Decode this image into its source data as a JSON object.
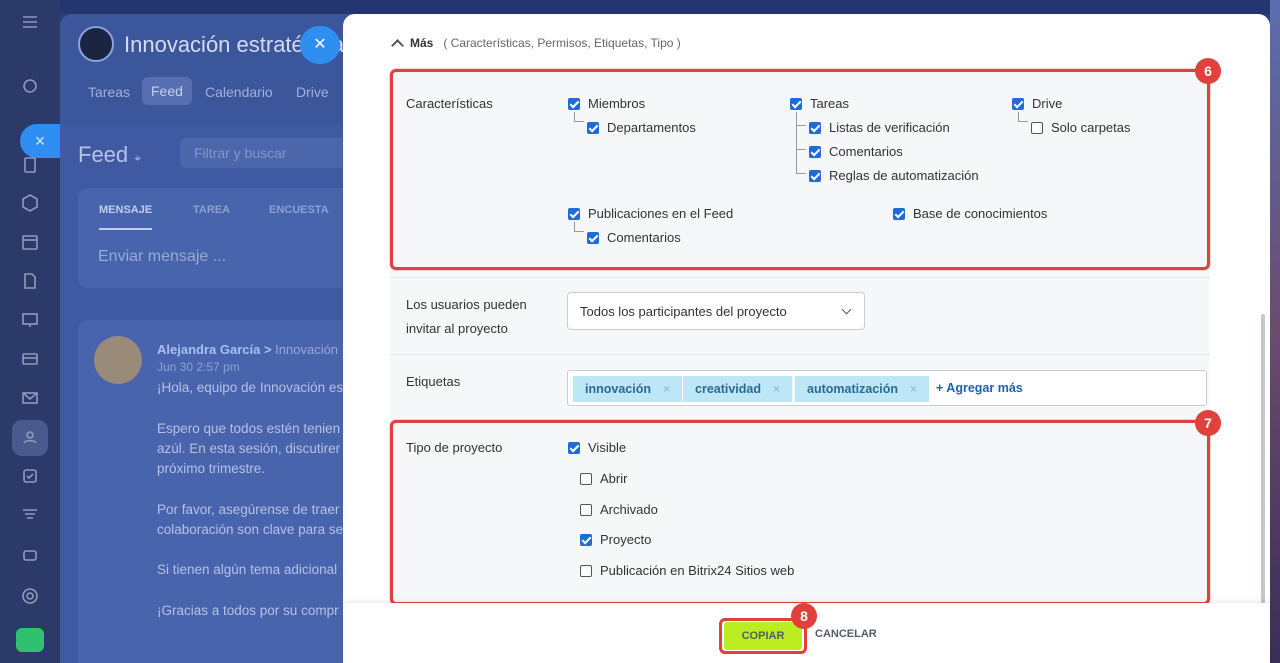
{
  "background": {
    "project_title": "Innovación estratégica",
    "tabs": [
      "Tareas",
      "Feed",
      "Calendario",
      "Drive"
    ],
    "feed_title": "Feed",
    "filter_placeholder": "Filtrar y buscar",
    "composer_tabs": [
      "MENSAJE",
      "TAREA",
      "ENCUESTA"
    ],
    "composer_placeholder": "Enviar mensaje ...",
    "post": {
      "author": "Alejandra García",
      "project": "Innovación",
      "date": "Jun 30 2:57 pm",
      "lines": [
        "¡Hola, equipo de Innovación es",
        "Espero que todos estén tenien",
        "azúl. En esta sesión, discutirer",
        "próximo trimestre.",
        "Por favor, asegúrense de traer",
        "colaboración son clave para se",
        "Si tienen algún tema adicional",
        "¡Gracias a todos por su compr"
      ]
    }
  },
  "modal": {
    "mas_label": "Más",
    "mas_sub": "( Características, Permisos, Etiquetas, Tipo )",
    "features": {
      "label": "Características",
      "items": {
        "miembros": {
          "label": "Miembros",
          "checked": true
        },
        "departamentos": {
          "label": "Departamentos",
          "checked": true
        },
        "tareas": {
          "label": "Tareas",
          "checked": true
        },
        "listas": {
          "label": "Listas de verificación",
          "checked": true
        },
        "comentarios_tareas": {
          "label": "Comentarios",
          "checked": true
        },
        "reglas": {
          "label": "Reglas de automatización",
          "checked": true
        },
        "drive": {
          "label": "Drive",
          "checked": true
        },
        "solo_carpetas": {
          "label": "Solo carpetas",
          "checked": false
        },
        "publicaciones": {
          "label": "Publicaciones en el Feed",
          "checked": true
        },
        "comentarios_feed": {
          "label": "Comentarios",
          "checked": true
        },
        "base": {
          "label": "Base de conocimientos",
          "checked": true
        }
      }
    },
    "invite": {
      "label_line1": "Los usuarios pueden",
      "label_line2": "invitar al proyecto",
      "value": "Todos los participantes del proyecto"
    },
    "tags": {
      "label": "Etiquetas",
      "items": [
        "innovación",
        "creatividad",
        "automatización"
      ],
      "remove_glyph": "×",
      "add_more": "+ Agregar más"
    },
    "project_type": {
      "label": "Tipo de proyecto",
      "visible": {
        "label": "Visible",
        "checked": true
      },
      "abrir": {
        "label": "Abrir",
        "checked": false
      },
      "archivado": {
        "label": "Archivado",
        "checked": false
      },
      "proyecto": {
        "label": "Proyecto",
        "checked": true
      },
      "publicacion": {
        "label": "Publicación en Bitrix24 Sitios web",
        "checked": false
      }
    },
    "badges": {
      "features": "6",
      "type": "7",
      "copy": "8"
    },
    "buttons": {
      "copy": "COPIAR",
      "cancel": "CANCELAR"
    }
  },
  "colors": {
    "accent": "#1f6cd8",
    "highlight": "#e0413c",
    "copy_button": "#bbed21",
    "tag_bg": "#bde6f7"
  }
}
